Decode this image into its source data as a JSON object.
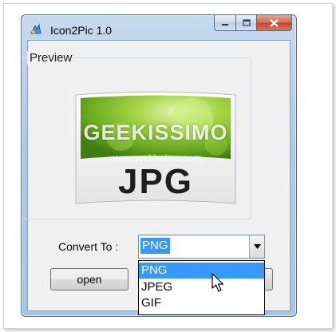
{
  "window": {
    "title": "Icon2Pic 1.0",
    "app_icon": "icon2pic-app-icon",
    "controls": {
      "minimize_icon": "minimize-icon",
      "maximize_icon": "maximize-icon",
      "close_icon": "close-icon",
      "close_color": "#c44426"
    }
  },
  "preview": {
    "group_label": "Preview",
    "image_text": "JPG",
    "watermark": "GEEKISSIMO",
    "watermark_url": "www.geekissimo.com",
    "accent_green": "#7fbf2a"
  },
  "convert": {
    "label": "Convert To :",
    "selected": "PNG",
    "options": [
      "PNG",
      "JPEG",
      "GIF"
    ],
    "highlighted_option": "PNG",
    "highlight_color": "#3399ff"
  },
  "buttons": {
    "open_label": "open"
  }
}
